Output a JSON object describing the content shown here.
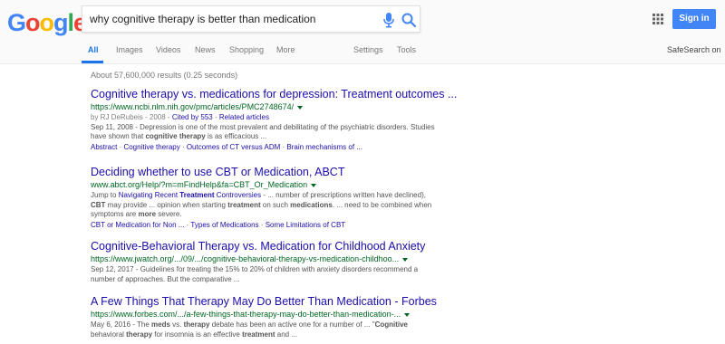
{
  "logo": {
    "letters": [
      "G",
      "o",
      "o",
      "g",
      "l",
      "e"
    ],
    "colors": [
      "#4285f4",
      "#ea4335",
      "#fbbc05",
      "#4285f4",
      "#34a853",
      "#ea4335"
    ]
  },
  "search": {
    "query": "why cognitive therapy is better than medication"
  },
  "header": {
    "signin_label": "Sign in",
    "safesearch_label": "SafeSearch on"
  },
  "tabs": [
    {
      "label": "All",
      "active": true
    },
    {
      "label": "Images"
    },
    {
      "label": "Videos"
    },
    {
      "label": "News"
    },
    {
      "label": "Shopping"
    },
    {
      "label": "More"
    },
    {
      "label": "Settings"
    },
    {
      "label": "Tools"
    }
  ],
  "stats": "About 57,600,000 results (0.25 seconds)",
  "results": [
    {
      "title": "Cognitive therapy vs. medications for depression: Treatment outcomes ...",
      "url": "https://www.ncbi.nlm.nih.gov/pmc/articles/PMC2748674/",
      "meta_prefix": "by RJ DeRubeis - 2008 - ",
      "meta_cited": "Cited by 553",
      "meta_sep": " - ",
      "meta_related": "Related articles",
      "snippet_1": "Sep 11, 2008 - Depression is one of the most prevalent and debilitating of the psychiatric disorders. Studies have shown that ",
      "snippet_b1": "cognitive therapy",
      "snippet_2": " is as efficacious ...",
      "sitelinks": [
        "Abstract",
        "Cognitive therapy",
        "Outcomes of CT versus ADM",
        "Brain mechanisms of ..."
      ]
    },
    {
      "title": "Deciding whether to use CBT or Medication, ABCT",
      "url": "www.abct.org/Help/?m=mFindHelp&fa=CBT_Or_Medication",
      "jump_prefix": "Jump to ",
      "jump_link": "Navigating Recent ",
      "jump_link_b": "Treatment",
      "jump_link_2": " Controversies",
      "snippet_1": " - ... number of prescriptions written have declined), ",
      "snippet_b1": "CBT",
      "snippet_2": " may provide ... opinion when starting ",
      "snippet_b2": "treatment",
      "snippet_3": " on such ",
      "snippet_b3": "medications",
      "snippet_4": ". ... need to be combined when symptoms are ",
      "snippet_b4": "more",
      "snippet_5": " severe.",
      "sitelinks": [
        "CBT or Medication for Non ...",
        "Types of Medications",
        "Some Limitations of CBT"
      ]
    },
    {
      "title": "Cognitive-Behavioral Therapy vs. Medication for Childhood Anxiety",
      "url": "https://www.jwatch.org/.../09/.../cognitive-behavioral-therapy-vs-medication-childhoo...",
      "snippet_1": "Sep 12, 2017 - Guidelines for treating the 15% to 20% of children with anxiety disorders recommend a number of approaches. But the comparative ..."
    },
    {
      "title": "A Few Things That Therapy May Do Better Than Medication - Forbes",
      "url": "https://www.forbes.com/.../a-few-things-that-therapy-may-do-better-than-medication-...",
      "snippet_1": "May 6, 2016 - The ",
      "snippet_b1": "meds",
      "snippet_2": " vs. ",
      "snippet_b2": "therapy",
      "snippet_3": " debate has been an active one for a number of ... \"",
      "snippet_b3": "Cognitive",
      "snippet_4": " behavioral ",
      "snippet_b4": "therapy",
      "snippet_5": " for insomnia is an effective ",
      "snippet_b5": "treatment",
      "snippet_6": " and ..."
    }
  ]
}
